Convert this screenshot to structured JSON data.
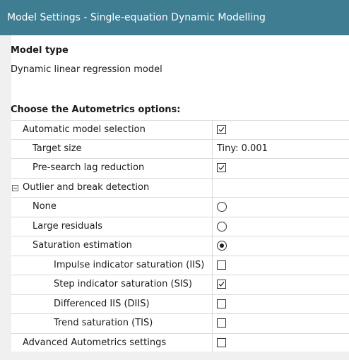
{
  "window": {
    "title": "Model Settings - Single-equation Dynamic Modelling"
  },
  "model_type": {
    "heading": "Model type",
    "value": "Dynamic linear regression model"
  },
  "autometrics": {
    "heading": "Choose the Autometrics options:",
    "rows": {
      "automatic_model_selection": {
        "label": "Automatic model selection",
        "checked": true
      },
      "target_size": {
        "label": "Target size",
        "value": "Tiny: 0.001"
      },
      "pre_search_lag_reduction": {
        "label": "Pre-search lag reduction",
        "checked": true
      },
      "outlier_break_detection": {
        "label": "Outlier and break detection",
        "expanded": true
      },
      "none": {
        "label": "None",
        "selected": false
      },
      "large_residuals": {
        "label": "Large residuals",
        "selected": false
      },
      "saturation_estimation": {
        "label": "Saturation estimation",
        "selected": true
      },
      "iis": {
        "label": "Impulse indicator saturation (IIS)",
        "checked": false
      },
      "sis": {
        "label": "Step indicator saturation (SIS)",
        "checked": true
      },
      "diis": {
        "label": "Differenced IIS (DIIS)",
        "checked": false
      },
      "tis": {
        "label": "Trend saturation (TIS)",
        "checked": false
      },
      "advanced": {
        "label": "Advanced Autometrics settings",
        "checked": false
      }
    }
  },
  "colors": {
    "titlebar": "#3f7d93",
    "panel": "#ffffff",
    "background": "#f0f0f0"
  }
}
